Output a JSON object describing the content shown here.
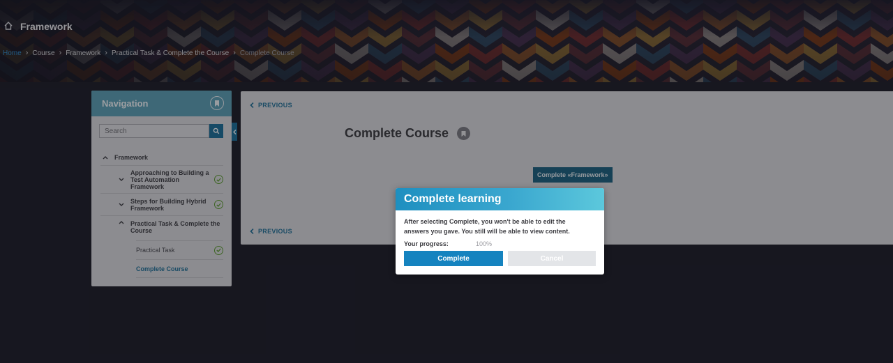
{
  "header": {
    "course_title": "Framework"
  },
  "breadcrumb": {
    "home": "Home",
    "items": [
      "Course",
      "Framework",
      "Practical Task & Complete the Course"
    ],
    "current": "Complete Course"
  },
  "navigation": {
    "title": "Navigation",
    "search_placeholder": "Search",
    "tree": {
      "root": "Framework",
      "items": [
        {
          "label": "Approaching to Building a Test Automation Framework",
          "completed": true
        },
        {
          "label": "Steps for Building Hybrid Framework",
          "completed": true
        },
        {
          "label": "Practical Task & Complete the Course",
          "completed": false,
          "children": [
            {
              "label": "Practical Task",
              "completed": true
            },
            {
              "label": "Complete Course",
              "completed": false,
              "active": true
            }
          ]
        }
      ]
    }
  },
  "content": {
    "previous_label": "PREVIOUS",
    "page_title": "Complete Course",
    "complete_button": "Complete «Framework»"
  },
  "modal": {
    "title": "Complete learning",
    "message": "After selecting Complete, you won't be able to edit the answers you gave. You still will be able to view content.",
    "progress_label": "Your progress:",
    "progress_value": "100%",
    "confirm_label": "Complete",
    "cancel_label": "Cancel"
  },
  "colors": {
    "accent": "#1583bf",
    "nav_header": "#5b9fb3",
    "check": "#5b9a2e",
    "link_active": "#1f6f95"
  },
  "icons": [
    "home-icon",
    "bookmark-icon",
    "search-icon",
    "chevron-up-icon",
    "chevron-down-icon",
    "check-circle-icon",
    "chevron-left-icon"
  ]
}
